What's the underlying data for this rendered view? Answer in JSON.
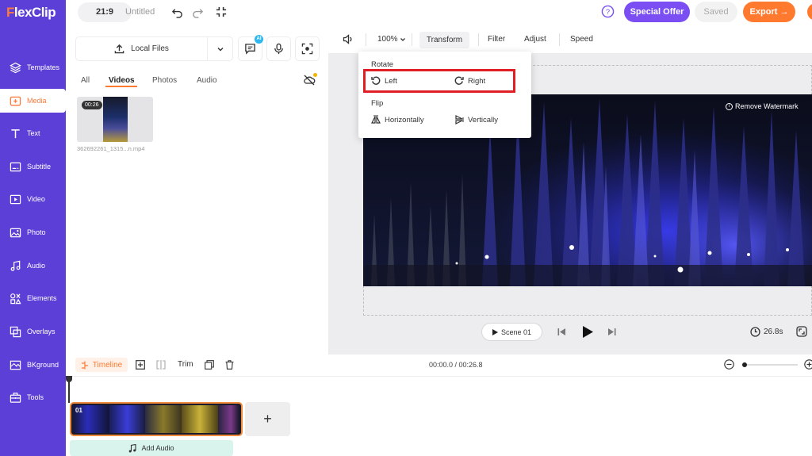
{
  "app": {
    "logo": "FlexClip"
  },
  "sidebar": {
    "items": [
      {
        "label": "Templates",
        "icon": "layers-icon"
      },
      {
        "label": "Media",
        "icon": "media-icon",
        "active": true
      },
      {
        "label": "Text",
        "icon": "text-icon"
      },
      {
        "label": "Subtitle",
        "icon": "subtitle-icon"
      },
      {
        "label": "Video",
        "icon": "video-icon"
      },
      {
        "label": "Photo",
        "icon": "photo-icon"
      },
      {
        "label": "Audio",
        "icon": "music-icon"
      },
      {
        "label": "Elements",
        "icon": "elements-icon"
      },
      {
        "label": "Overlays",
        "icon": "overlays-icon"
      },
      {
        "label": "BKground",
        "icon": "background-icon"
      },
      {
        "label": "Tools",
        "icon": "tools-icon"
      }
    ]
  },
  "topbar": {
    "ratio": "21:9",
    "title": "Untitled",
    "special_offer": "Special Offer",
    "saved": "Saved",
    "export": "Export →"
  },
  "media": {
    "local_files": "Local Files",
    "ai_badge": "AI",
    "tabs": [
      "All",
      "Videos",
      "Photos",
      "Audio"
    ],
    "active_tab": "Videos",
    "items": [
      {
        "duration": "00:26",
        "name": "362692261_1315...n.mp4"
      }
    ]
  },
  "toolbar": {
    "zoom": "100%",
    "items": [
      "Transform",
      "Filter",
      "Adjust",
      "Speed"
    ]
  },
  "transform_menu": {
    "rotate_heading": "Rotate",
    "rotate_left": "Left",
    "rotate_right": "Right",
    "flip_heading": "Flip",
    "flip_horizontal": "Horizontally",
    "flip_vertical": "Vertically"
  },
  "preview": {
    "remove_watermark": "Remove Watermark"
  },
  "player": {
    "scene": "Scene 01",
    "duration": "26.8s"
  },
  "timeline": {
    "label": "Timeline",
    "trim": "Trim",
    "time": "00:00.0 / 00:26.8",
    "clip_number": "01",
    "add_audio": "Add Audio"
  },
  "colors": {
    "sidebar": "#5b3fd6",
    "accent": "#ff7a2f",
    "special_offer": "#7a4ef2",
    "highlight_box": "#e01e26"
  }
}
